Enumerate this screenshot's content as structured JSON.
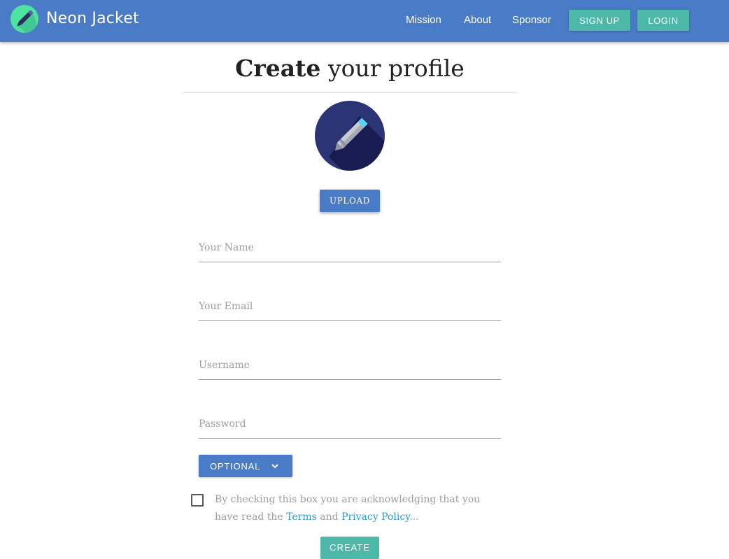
{
  "header": {
    "brand": "Neon Jacket",
    "nav": [
      "Mission",
      "About",
      "Sponsor"
    ],
    "signup_label": "SIGN UP",
    "login_label": "LOGIN"
  },
  "page": {
    "title_bold": "Create",
    "title_rest": "your profile"
  },
  "upload_label": "UPLOAD",
  "form": {
    "name_placeholder": "Your Name",
    "email_placeholder": "Your Email",
    "username_placeholder": "Username",
    "password_placeholder": "Password",
    "optional_label": "OPTIONAL",
    "agree_prefix": "By checking this box you are acknowledging that you have read the",
    "terms_label": "Terms",
    "and_text": "and",
    "privacy_label": "Privacy Policy",
    "agree_suffix": "...",
    "create_label": "CREATE",
    "checkbox_checked": false
  },
  "icons": {
    "logo": "pen-icon",
    "avatar": "pen-icon",
    "optional_caret": "chevron-down-icon"
  },
  "colors": {
    "header": "#4a7bc7",
    "accent_teal": "#4db8a8",
    "logo_bg": "#4ee3a0",
    "avatar_bg": "#2b3475",
    "link": "#2a9fd6"
  }
}
